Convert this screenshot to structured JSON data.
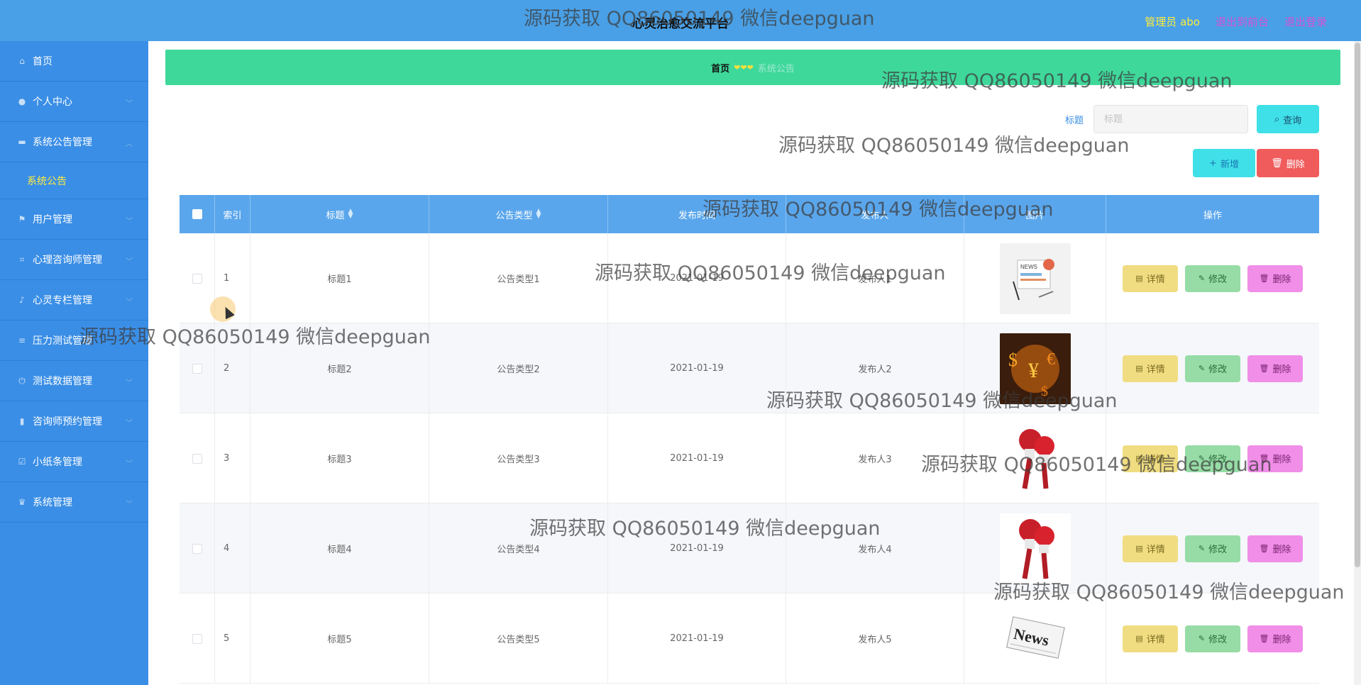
{
  "header": {
    "title": "心灵治愈交流平台",
    "admin": "管理员 abo",
    "back_to_front": "退出到前台",
    "logout": "退出登录"
  },
  "sidebar": {
    "items": [
      {
        "label": "首页",
        "icon": "home-icon",
        "expandable": false
      },
      {
        "label": "个人中心",
        "icon": "user-icon",
        "expandable": true
      },
      {
        "label": "系统公告管理",
        "icon": "notice-icon",
        "expandable": true,
        "expanded": true,
        "children": [
          "系统公告"
        ]
      },
      {
        "label": "用户管理",
        "icon": "flag-icon",
        "expandable": true
      },
      {
        "label": "心理咨询师管理",
        "icon": "crop-icon",
        "expandable": true
      },
      {
        "label": "心灵专栏管理",
        "icon": "mic-icon",
        "expandable": true
      },
      {
        "label": "压力测试管理",
        "icon": "stack-icon",
        "expandable": true
      },
      {
        "label": "测试数据管理",
        "icon": "power-icon",
        "expandable": true
      },
      {
        "label": "咨询师预约管理",
        "icon": "bar-chart-icon",
        "expandable": true
      },
      {
        "label": "小纸条管理",
        "icon": "check-icon",
        "expandable": true
      },
      {
        "label": "系统管理",
        "icon": "trophy-icon",
        "expandable": true
      }
    ]
  },
  "breadcrumb": {
    "home": "首页",
    "separator": "❤❤❤",
    "current": "系统公告"
  },
  "search": {
    "label": "标题",
    "placeholder": "标题",
    "query_button": "查询"
  },
  "actions": {
    "add": "新增",
    "delete": "删除"
  },
  "table": {
    "columns": [
      "索引",
      "标题",
      "公告类型",
      "发布时间",
      "发布人",
      "图片",
      "操作"
    ],
    "sortable": {
      "标题": true,
      "公告类型": true
    },
    "rows": [
      {
        "index": "1",
        "title": "标题1",
        "type": "公告类型1",
        "date": "2021-01-19",
        "publisher": "发布人1",
        "image": "news-illustration"
      },
      {
        "index": "2",
        "title": "标题2",
        "type": "公告类型2",
        "date": "2021-01-19",
        "publisher": "发布人2",
        "image": "dollar-symbols"
      },
      {
        "index": "3",
        "title": "标题3",
        "type": "公告类型3",
        "date": "2021-01-19",
        "publisher": "发布人3",
        "image": "red-microphones"
      },
      {
        "index": "4",
        "title": "标题4",
        "type": "公告类型4",
        "date": "2021-01-19",
        "publisher": "发布人4",
        "image": "red-microphones"
      },
      {
        "index": "5",
        "title": "标题5",
        "type": "公告类型5",
        "date": "2021-01-19",
        "publisher": "发布人5",
        "image": "news-paper"
      }
    ],
    "row_actions": {
      "detail": "详情",
      "edit": "修改",
      "delete": "删除"
    }
  },
  "watermark": "源码获取 QQ86050149 微信deepguan",
  "colors": {
    "header": "#4aa0e6",
    "sidebar": "#3a8ee6",
    "breadcrumb": "#3fd89b",
    "table_header": "#5aa6ec",
    "accent_yellow": "#ffec3d"
  }
}
